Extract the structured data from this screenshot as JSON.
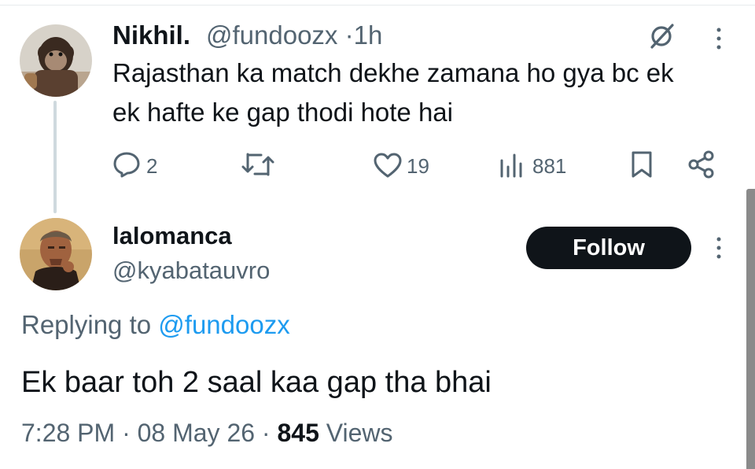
{
  "tweet1": {
    "display_name": "Nikhil.",
    "handle": "@fundoozx",
    "separator": "·",
    "time": "1h",
    "text_line1": "Rajasthan ka match dekhe zamana ho gya bc ek",
    "text_line2": "ek hafte ke gap thodi hote hai",
    "replies": "2",
    "likes": "19",
    "views": "881",
    "avatar_icon": "chimpanzee-avatar",
    "icons": [
      "grok-icon",
      "more-icon",
      "reply-icon",
      "retweet-icon",
      "like-icon",
      "views-icon",
      "bookmark-icon",
      "share-icon"
    ]
  },
  "tweet2": {
    "display_name": "lalomanca",
    "handle": "@kyabatauvro",
    "follow_label": "Follow",
    "replying_prefix": "Replying to",
    "replying_handle": "@fundoozx",
    "text": "Ek baar toh 2 saal kaa gap tha bhai",
    "time": "7:28 PM",
    "separator": "·",
    "date": "08 May 26",
    "views_count": "845",
    "views_label": "Views",
    "avatar_icon": "man-portrait-avatar"
  },
  "colors": {
    "text": "#0f1419",
    "muted": "#536471",
    "link": "#1d9bf0",
    "button_bg": "#0f1419",
    "thread_line": "#cfd9de"
  }
}
